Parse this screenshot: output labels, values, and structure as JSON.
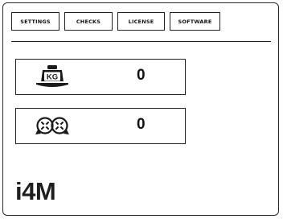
{
  "tabs": [
    {
      "label": "SETTINGS"
    },
    {
      "label": "CHECKS"
    },
    {
      "label": "LICENSE"
    },
    {
      "label": "SOFTWARE"
    }
  ],
  "weight_panel": {
    "icon": "weight-scale-icon",
    "icon_label": "KG",
    "value": "0"
  },
  "counter_panel": {
    "icon": "rotation-counter-icon",
    "value": "0"
  },
  "brand": {
    "logo_text": "i4M"
  }
}
